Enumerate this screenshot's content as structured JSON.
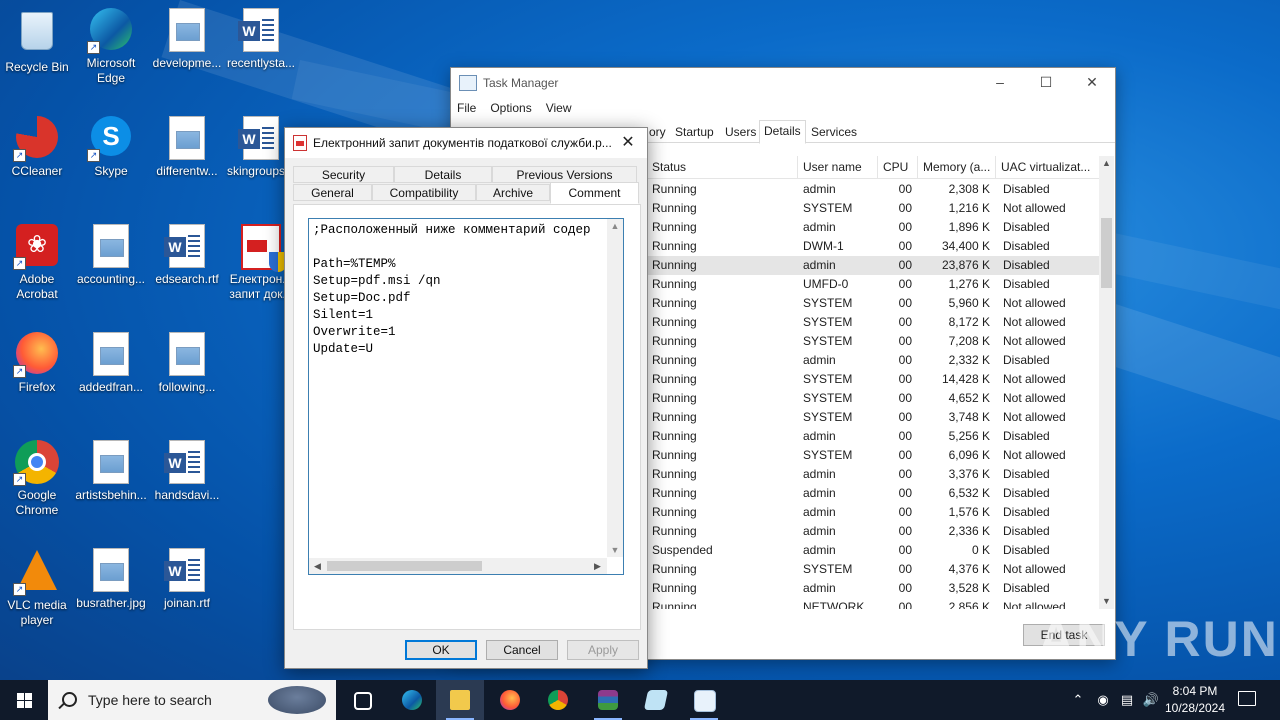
{
  "desktop": {
    "icons": [
      {
        "label": "Recycle Bin",
        "icon": "recycle-bin-icon"
      },
      {
        "label": "Microsoft Edge",
        "icon": "edge-icon"
      },
      {
        "label": "developme...",
        "icon": "image-file-icon"
      },
      {
        "label": "recentlysta...",
        "icon": "word-doc-icon"
      },
      {
        "label": "CCleaner",
        "icon": "ccleaner-icon"
      },
      {
        "label": "Skype",
        "icon": "skype-icon"
      },
      {
        "label": "differentw...",
        "icon": "image-file-icon"
      },
      {
        "label": "skingroups...",
        "icon": "word-doc-icon"
      },
      {
        "label": "Adobe Acrobat",
        "icon": "acrobat-icon"
      },
      {
        "label": "accounting...",
        "icon": "image-file-icon"
      },
      {
        "label": "edsearch.rtf",
        "icon": "word-doc-icon"
      },
      {
        "label": "Електрон... запит док...",
        "icon": "pdf-shield-icon"
      },
      {
        "label": "Firefox",
        "icon": "firefox-icon"
      },
      {
        "label": "addedfran...",
        "icon": "image-file-icon"
      },
      {
        "label": "following...",
        "icon": "image-file-icon"
      },
      {
        "label": "Google Chrome",
        "icon": "chrome-icon"
      },
      {
        "label": "artistsbehin...",
        "icon": "image-file-icon"
      },
      {
        "label": "handsdavi...",
        "icon": "word-doc-icon"
      },
      {
        "label": "VLC media player",
        "icon": "vlc-icon"
      },
      {
        "label": "busrather.jpg",
        "icon": "image-file-icon"
      },
      {
        "label": "joinan.rtf",
        "icon": "word-doc-icon"
      }
    ]
  },
  "task_manager": {
    "title": "Task Manager",
    "menu": [
      "File",
      "Options",
      "View"
    ],
    "tabs": [
      "ory",
      "Startup",
      "Users",
      "Details",
      "Services"
    ],
    "active_tab": "Details",
    "columns": [
      "Status",
      "User name",
      "CPU",
      "Memory (a...",
      "UAC virtualizat..."
    ],
    "rows": [
      [
        "Running",
        "admin",
        "00",
        "2,308 K",
        "Disabled"
      ],
      [
        "Running",
        "SYSTEM",
        "00",
        "1,216 K",
        "Not allowed"
      ],
      [
        "Running",
        "admin",
        "00",
        "1,896 K",
        "Disabled"
      ],
      [
        "Running",
        "DWM-1",
        "00",
        "34,400 K",
        "Disabled"
      ],
      [
        "Running",
        "admin",
        "00",
        "23,876 K",
        "Disabled"
      ],
      [
        "Running",
        "UMFD-0",
        "00",
        "1,276 K",
        "Disabled"
      ],
      [
        "Running",
        "SYSTEM",
        "00",
        "5,960 K",
        "Not allowed"
      ],
      [
        "Running",
        "SYSTEM",
        "00",
        "8,172 K",
        "Not allowed"
      ],
      [
        "Running",
        "SYSTEM",
        "00",
        "7,208 K",
        "Not allowed"
      ],
      [
        "Running",
        "admin",
        "00",
        "2,332 K",
        "Disabled"
      ],
      [
        "Running",
        "SYSTEM",
        "00",
        "14,428 K",
        "Not allowed"
      ],
      [
        "Running",
        "SYSTEM",
        "00",
        "4,652 K",
        "Not allowed"
      ],
      [
        "Running",
        "SYSTEM",
        "00",
        "3,748 K",
        "Not allowed"
      ],
      [
        "Running",
        "admin",
        "00",
        "5,256 K",
        "Disabled"
      ],
      [
        "Running",
        "SYSTEM",
        "00",
        "6,096 K",
        "Not allowed"
      ],
      [
        "Running",
        "admin",
        "00",
        "3,376 K",
        "Disabled"
      ],
      [
        "Running",
        "admin",
        "00",
        "6,532 K",
        "Disabled"
      ],
      [
        "Running",
        "admin",
        "00",
        "1,576 K",
        "Disabled"
      ],
      [
        "Running",
        "admin",
        "00",
        "2,336 K",
        "Disabled"
      ],
      [
        "Suspended",
        "admin",
        "00",
        "0 K",
        "Disabled"
      ],
      [
        "Running",
        "SYSTEM",
        "00",
        "4,376 K",
        "Not allowed"
      ],
      [
        "Running",
        "admin",
        "00",
        "3,528 K",
        "Disabled"
      ],
      [
        "Running",
        "NETWORK",
        "00",
        "2,856 K",
        "Not allowed"
      ]
    ],
    "selected_row": 4,
    "end_task_label": "End task"
  },
  "properties_dialog": {
    "title": "Електронний запит документів податкової служби.p...",
    "tabs_row1": [
      "Security",
      "Details",
      "Previous Versions"
    ],
    "tabs_row2": [
      "General",
      "Compatibility",
      "Archive",
      "Comment"
    ],
    "active_tab": "Comment",
    "comment_lines": [
      ";Расположенный ниже комментарий содер",
      "",
      "Path=%TEMP%",
      "Setup=pdf.msi /qn",
      "Setup=Doc.pdf",
      "Silent=1",
      "Overwrite=1",
      "Update=U"
    ],
    "ok_label": "OK",
    "cancel_label": "Cancel",
    "apply_label": "Apply"
  },
  "taskbar": {
    "search_placeholder": "Type here to search",
    "time": "8:04 PM",
    "date": "10/28/2024"
  },
  "watermark": "ANY RUN"
}
